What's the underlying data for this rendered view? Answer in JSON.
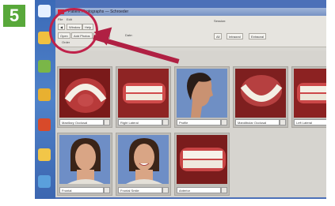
{
  "step": {
    "number": "5",
    "color": "#58a83a"
  },
  "window": {
    "title": "Patient Photographs — Schroeder"
  },
  "toolbar": {
    "file_label": "File",
    "edit_label": "Edit",
    "view_label": "Window",
    "help_label": "Help",
    "back_label": "◀",
    "open_label": "Open",
    "add_button": "Add Photos",
    "remove_button": "Remove",
    "order_label": "Order",
    "date_label": "Date:",
    "sort_options": [
      "All",
      "Intraoral",
      "Extraoral"
    ],
    "right_label": "Session:"
  },
  "annotation": {
    "ring_color": "#c0224a",
    "arrow_color": "#b02043"
  },
  "thumbnails": [
    {
      "caption": "Maxillary Occlusal",
      "kind": "occlusal-upper"
    },
    {
      "caption": "Right Lateral",
      "kind": "teeth-right"
    },
    {
      "caption": "Profile",
      "kind": "profile"
    },
    {
      "caption": "Mandibular Occlusal",
      "kind": "occlusal-lower"
    },
    {
      "caption": "Left Lateral",
      "kind": "teeth-left"
    },
    {
      "caption": "Frontal",
      "kind": "face-frontal"
    },
    {
      "caption": "Frontal Smile",
      "kind": "face-smile"
    },
    {
      "caption": "Anterior",
      "kind": "teeth-front"
    }
  ]
}
